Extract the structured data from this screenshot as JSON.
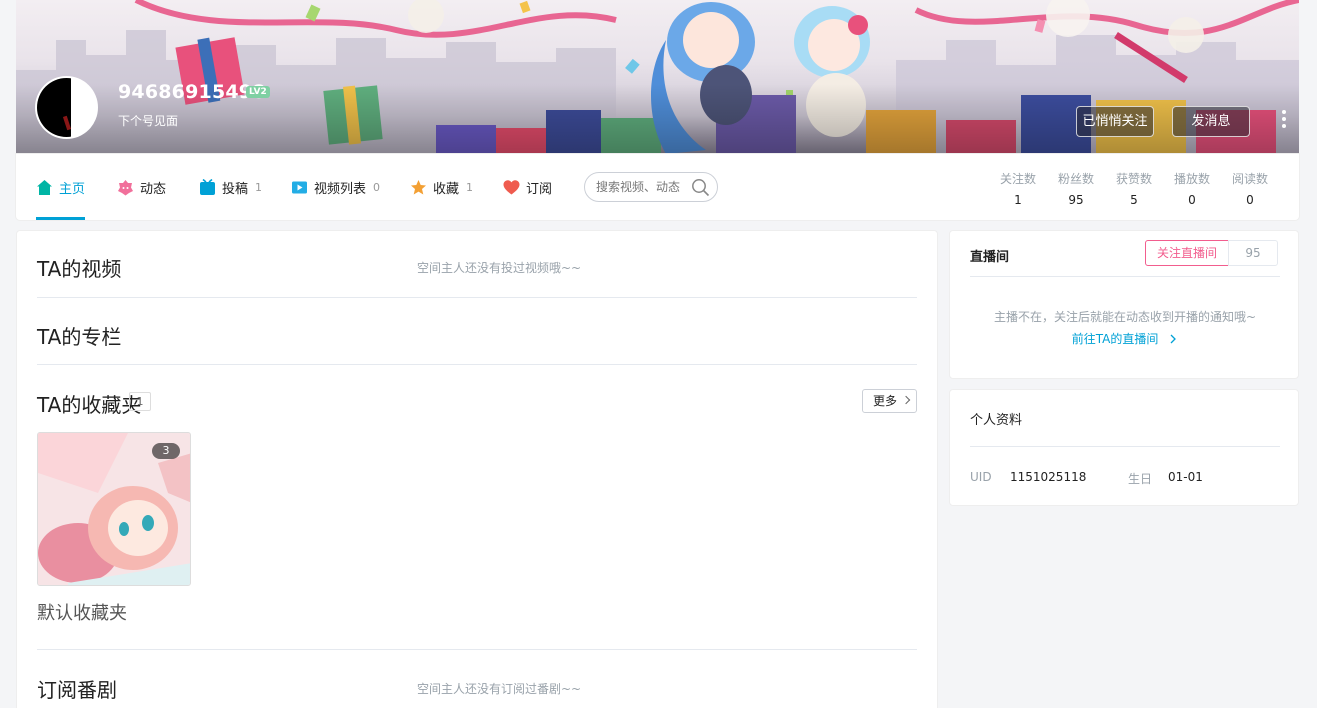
{
  "header": {
    "username": "94686915498",
    "level_badge": "LV2",
    "signature": "下个号见面",
    "follow_button": "已悄悄关注",
    "message_button": "发消息"
  },
  "nav": {
    "tabs": [
      {
        "label": "主页",
        "count": "",
        "icon": "home-icon",
        "color": "#00b5a5"
      },
      {
        "label": "动态",
        "count": "",
        "icon": "dynamic-icon",
        "color": "#f1709b"
      },
      {
        "label": "投稿",
        "count": "1",
        "icon": "tv-icon",
        "color": "#00a1d6"
      },
      {
        "label": "视频列表",
        "count": "0",
        "icon": "playlist-icon",
        "color": "#00a1d6"
      },
      {
        "label": "收藏",
        "count": "1",
        "icon": "star-icon",
        "color": "#f3a034"
      },
      {
        "label": "订阅",
        "count": "",
        "icon": "heart-icon",
        "color": "#ef5b4e"
      }
    ],
    "search_placeholder": "搜索视频、动态",
    "stats": [
      {
        "label": "关注数",
        "value": "1"
      },
      {
        "label": "粉丝数",
        "value": "95"
      },
      {
        "label": "获赞数",
        "value": "5"
      },
      {
        "label": "播放数",
        "value": "0"
      },
      {
        "label": "阅读数",
        "value": "0"
      }
    ]
  },
  "main": {
    "videos": {
      "title": "TA的视频",
      "empty": "空间主人还没有投过视频哦~~"
    },
    "column": {
      "title": "TA的专栏"
    },
    "favorites": {
      "title": "TA的收藏夹",
      "count": "1",
      "more": "更多",
      "folder_name": "默认收藏夹",
      "folder_count": "3"
    },
    "bangumi": {
      "title": "订阅番剧",
      "empty": "空间主人还没有订阅过番剧~~"
    }
  },
  "sidebar": {
    "live": {
      "title": "直播间",
      "follow_live": "关注直播间",
      "fans": "95",
      "tip": "主播不在，关注后就能在动态收到开播的通知哦~",
      "link": "前往TA的直播间"
    },
    "profile": {
      "title": "个人资料",
      "uid_label": "UID",
      "uid": "1151025118",
      "birthday_label": "生日",
      "birthday": "01-01"
    }
  },
  "colors": {
    "accent": "#00a1d6",
    "pink": "#f25d8e"
  }
}
